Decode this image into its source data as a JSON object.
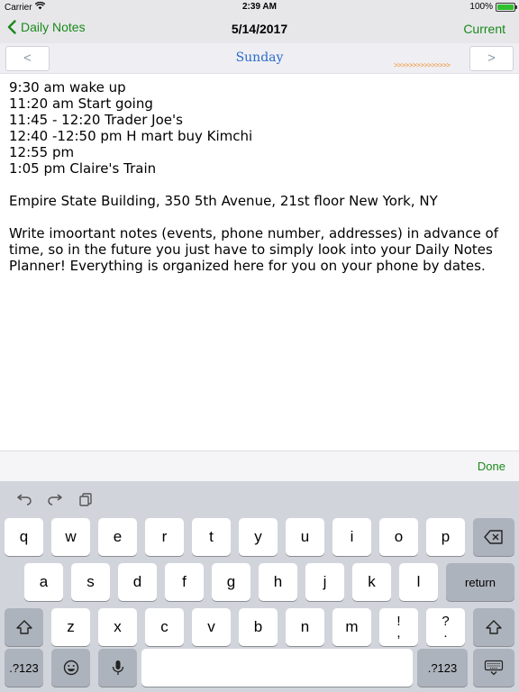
{
  "status_bar": {
    "carrier": "Carrier",
    "time": "2:39 AM",
    "battery": "100%",
    "battery_level": 1.0
  },
  "nav": {
    "back_label": "Daily Notes",
    "title": "5/14/2017",
    "current_label": "Current"
  },
  "day_bar": {
    "prev_label": "<",
    "next_label": ">",
    "day_name": "Sunday",
    "arrow_glyphs": ">>>>>>>>>>>>>>>"
  },
  "notes": {
    "lines": [
      "9:30 am wake up",
      "11:20 am Start going",
      "11:45 - 12:20 Trader Joe's",
      "12:40 -12:50 pm H mart buy Kimchi",
      "12:55 pm",
      "1:05 pm Claire's Train"
    ],
    "address": "Empire State Building, 350 5th Avenue, 21st floor New York, NY",
    "paragraph": "Write imoortant notes (events, phone number, addresses) in advance of time, so in the future you just have to simply look into your Daily Notes Planner! Everything is organized here for you on your phone by dates."
  },
  "done_bar": {
    "done_label": "Done"
  },
  "keyboard": {
    "row1": [
      "q",
      "w",
      "e",
      "r",
      "t",
      "y",
      "u",
      "i",
      "o",
      "p"
    ],
    "row2": [
      "a",
      "s",
      "d",
      "f",
      "g",
      "h",
      "j",
      "k",
      "l"
    ],
    "return_label": "return",
    "row3": [
      "z",
      "x",
      "c",
      "v",
      "b",
      "n",
      "m"
    ],
    "punct1_top": "!",
    "punct1_bottom": ",",
    "punct2_top": "?",
    "punct2_bottom": ".",
    "numbers_left": ".?123",
    "numbers_right": ".?123"
  },
  "icons": {
    "back": "chevron-left-icon",
    "wifi": "wifi-icon",
    "battery": "battery-icon",
    "undo": "undo-icon",
    "redo": "redo-icon",
    "paste": "paste-icon",
    "backspace": "backspace-icon",
    "shift": "shift-icon",
    "emoji": "emoji-icon",
    "microphone": "microphone-icon",
    "keyboard_dismiss": "keyboard-dismiss-icon"
  },
  "colors": {
    "accent_green": "#1a8a1a",
    "day_blue": "#2a6bc9",
    "arrow_orange": "#f08a24",
    "battery_green": "#2fbf2f"
  }
}
